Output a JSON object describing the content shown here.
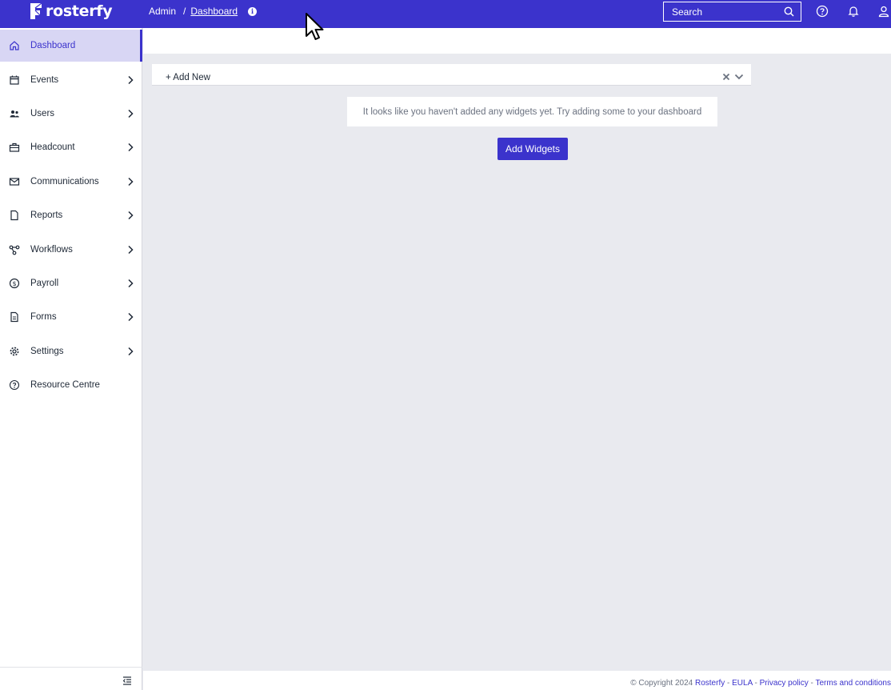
{
  "brand": {
    "name": "rosterfy"
  },
  "breadcrumb": {
    "root": "Admin",
    "separator": "/",
    "current": "Dashboard"
  },
  "search": {
    "placeholder": "Search"
  },
  "sidebar": {
    "items": [
      {
        "label": "Dashboard",
        "icon": "home-icon",
        "active": true,
        "has_children": false
      },
      {
        "label": "Events",
        "icon": "calendar-icon",
        "has_children": true
      },
      {
        "label": "Users",
        "icon": "users-icon",
        "has_children": true
      },
      {
        "label": "Headcount",
        "icon": "briefcase-icon",
        "has_children": true
      },
      {
        "label": "Communications",
        "icon": "mail-icon",
        "has_children": true
      },
      {
        "label": "Reports",
        "icon": "file-icon",
        "has_children": true
      },
      {
        "label": "Workflows",
        "icon": "workflow-icon",
        "has_children": true
      },
      {
        "label": "Payroll",
        "icon": "dollar-icon",
        "has_children": true
      },
      {
        "label": "Forms",
        "icon": "form-icon",
        "has_children": true
      },
      {
        "label": "Settings",
        "icon": "gear-icon",
        "has_children": true
      },
      {
        "label": "Resource Centre",
        "icon": "help-icon",
        "has_children": false
      }
    ]
  },
  "main": {
    "add_new_label": "+ Add New",
    "empty_message": "It looks like you haven't added any widgets yet. Try adding some to your dashboard",
    "add_widgets_label": "Add Widgets"
  },
  "footer": {
    "copyright": "© Copyright 2024",
    "brand_link": "Rosterfy",
    "sep": "-",
    "eula": "EULA",
    "privacy": "Privacy policy",
    "terms": "Terms and conditions"
  },
  "colors": {
    "primary": "#3b33cc",
    "active_bg": "#d8d6f4",
    "page_bg": "#e9eaef"
  }
}
